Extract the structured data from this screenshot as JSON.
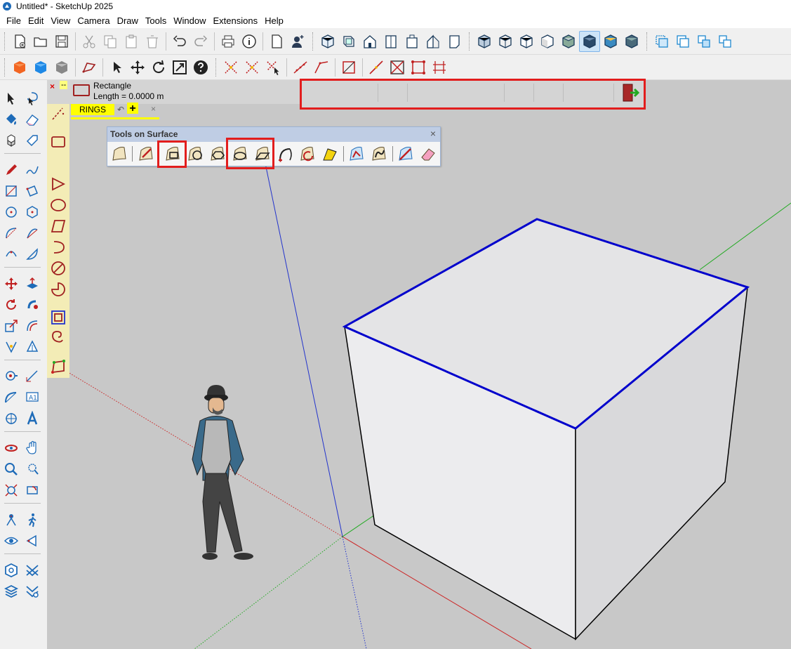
{
  "window": {
    "title": "Untitled* - SketchUp 2025"
  },
  "menu": [
    "File",
    "Edit",
    "View",
    "Camera",
    "Draw",
    "Tools",
    "Window",
    "Extensions",
    "Help"
  ],
  "tool_info": {
    "name": "Rectangle",
    "length": "Length = 0.0000 m",
    "close_label": "×",
    "minimize_label": "--"
  },
  "rings_tab": {
    "label": "RINGS",
    "undo_label": "↶",
    "add_label": "+",
    "close_label": "×"
  },
  "palette": {
    "title": "Tools on Surface",
    "close_label": "×"
  },
  "colors": {
    "blue_edge": "#0000cc",
    "axis_red": "#cc2222",
    "axis_green": "#22aa22",
    "axis_blue": "#2233cc",
    "highlight": "#e21d1d",
    "accent_red": "#a02020"
  },
  "icons": {
    "toolbar_1": [
      "new-file-icon",
      "open-folder-icon",
      "save-icon",
      "cut-icon",
      "copy-icon",
      "paste-icon",
      "erase-icon",
      "undo-icon",
      "redo-icon",
      "print-icon",
      "model-info-icon",
      "new-doc-icon",
      "add-user-icon",
      "iso-view-icon",
      "top-view-icon",
      "front-view-icon",
      "right-view-icon",
      "back-view-icon",
      "left-view-icon",
      "bottom-view-icon",
      "xray-style-icon",
      "wireframe-style-icon",
      "hidden-line-style-icon",
      "shaded-style-icon",
      "shaded-texture-style-icon",
      "monochrome-style-icon",
      "section-plane-icon",
      "section-display-icon",
      "section-cut-icon",
      "section-fill-icon"
    ],
    "toolbar_2": [
      "component-icon",
      "material-icon",
      "style-icon",
      "lasso-icon",
      "select-icon",
      "move-icon",
      "orbit-icon",
      "zoom-extents-icon",
      "help-icon",
      "axes-icon",
      "snap-icon",
      "snap-cursor-icon",
      "line-icon",
      "polyline-icon",
      "rectangle-frame-icon",
      "line-red-icon",
      "cross-box-icon",
      "grid-box-icon",
      "grid-lines-icon"
    ]
  }
}
